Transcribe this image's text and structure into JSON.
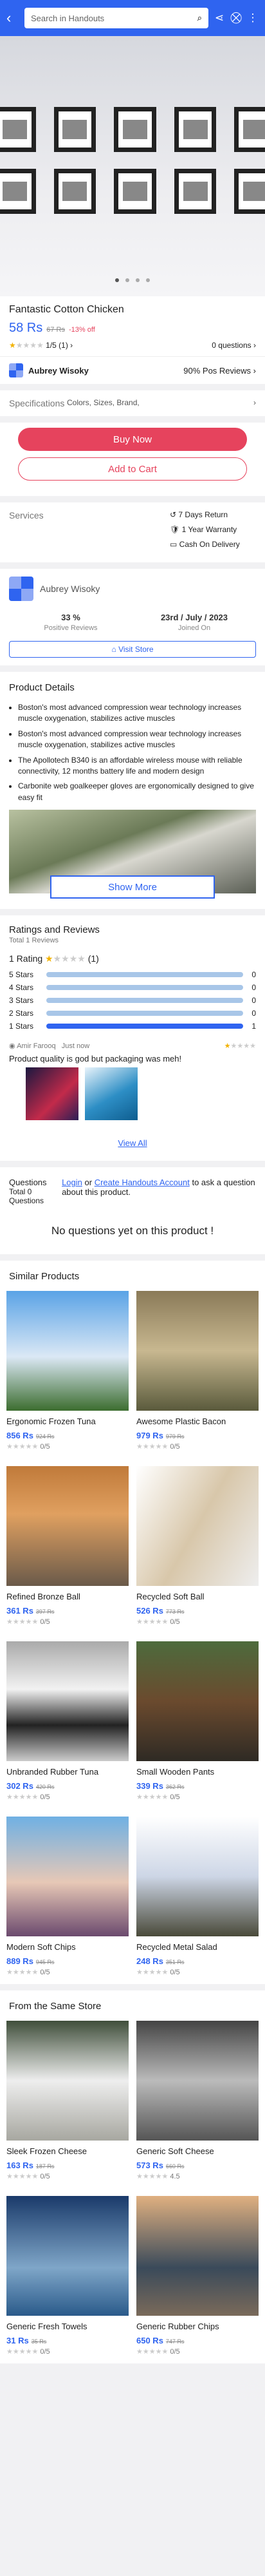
{
  "header": {
    "search_placeholder": "Search in Handouts"
  },
  "product": {
    "title": "Fantastic Cotton Chicken",
    "price": "58 Rs",
    "old_price": "67 Rs",
    "discount": "-13% off",
    "rating": "1/5 (1)",
    "questions": "0 questions"
  },
  "vendor": {
    "name": "Aubrey Wisoky",
    "positive": "90% Pos Reviews"
  },
  "specifications": {
    "label": "Specifications",
    "value": "Colors, Sizes, Brand,"
  },
  "actions": {
    "buy": "Buy Now",
    "cart": "Add to Cart"
  },
  "services": {
    "label": "Services",
    "items": [
      "7 Days Return",
      "1 Year Warranty",
      "Cash On Delivery"
    ]
  },
  "seller": {
    "name": "Aubrey Wisoky",
    "positive_value": "33 %",
    "positive_label": "Positive Reviews",
    "joined_value": "23rd / July / 2023",
    "joined_label": "Joined On",
    "visit": "Visit Store"
  },
  "details": {
    "title": "Product Details",
    "bullets": [
      "Boston's most advanced compression wear technology increases muscle oxygenation, stabilizes active muscles",
      "Boston's most advanced compression wear technology increases muscle oxygenation, stabilizes active muscles",
      "The Apollotech B340 is an affordable wireless mouse with reliable connectivity, 12 months battery life and modern design",
      "Carbonite web goalkeeper gloves are ergonomically designed to give easy fit"
    ],
    "show_more": "Show More"
  },
  "reviews": {
    "title": "Ratings and Reviews",
    "total": "Total 1 Reviews",
    "rating_label": "1 Rating",
    "rating_count": "(1)",
    "bars": [
      {
        "label": "5 Stars",
        "count": "0",
        "fraction": 0
      },
      {
        "label": "4 Stars",
        "count": "0",
        "fraction": 0
      },
      {
        "label": "3 Stars",
        "count": "0",
        "fraction": 0
      },
      {
        "label": "2 Stars",
        "count": "0",
        "fraction": 0
      },
      {
        "label": "1 Stars",
        "count": "1",
        "fraction": 1
      }
    ],
    "reviewer": "Amir Farooq",
    "time": "Just now",
    "text": "Product quality is god but packaging was meh!",
    "view_all": "View All"
  },
  "questions": {
    "label": "Questions",
    "total": "Total 0 Questions",
    "login": "Login",
    "or": "or",
    "create": "Create Handouts Account",
    "ask": "to ask a question about this product.",
    "none": "No questions yet on this product !"
  },
  "similar": {
    "title": "Similar Products",
    "items": [
      {
        "name": "Ergonomic Frozen Tuna",
        "price": "856 Rs",
        "old": "924 Rs",
        "rating": "0/5"
      },
      {
        "name": "Awesome Plastic Bacon",
        "price": "979 Rs",
        "old": "979 Rs",
        "rating": "0/5"
      },
      {
        "name": "Refined Bronze Ball",
        "price": "361 Rs",
        "old": "397 Rs",
        "rating": "0/5"
      },
      {
        "name": "Recycled Soft Ball",
        "price": "526 Rs",
        "old": "773 Rs",
        "rating": "0/5"
      },
      {
        "name": "Unbranded Rubber Tuna",
        "price": "302 Rs",
        "old": "420 Rs",
        "rating": "0/5"
      },
      {
        "name": "Small Wooden Pants",
        "price": "339 Rs",
        "old": "362 Rs",
        "rating": "0/5"
      },
      {
        "name": "Modern Soft Chips",
        "price": "889 Rs",
        "old": "945 Rs",
        "rating": "0/5"
      },
      {
        "name": "Recycled Metal Salad",
        "price": "248 Rs",
        "old": "351 Rs",
        "rating": "0/5"
      }
    ]
  },
  "store": {
    "title": "From the Same Store",
    "items": [
      {
        "name": "Sleek Frozen Cheese",
        "price": "163 Rs",
        "old": "187 Rs",
        "rating": "0/5"
      },
      {
        "name": "Generic Soft Cheese",
        "price": "573 Rs",
        "old": "660 Rs",
        "rating": "4.5"
      },
      {
        "name": "Generic Fresh Towels",
        "price": "31 Rs",
        "old": "35 Rs",
        "rating": "0/5"
      },
      {
        "name": "Generic Rubber Chips",
        "price": "650 Rs",
        "old": "747 Rs",
        "rating": "0/5"
      }
    ]
  },
  "colors": {
    "primary": "#2f64f0",
    "accent": "#e6435d",
    "star": "#f2b200"
  }
}
